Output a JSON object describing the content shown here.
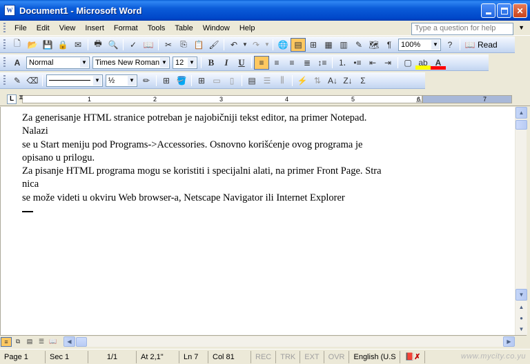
{
  "window": {
    "title": "Document1 - Microsoft Word",
    "icon_text": "W"
  },
  "menubar": {
    "items": [
      "File",
      "Edit",
      "View",
      "Insert",
      "Format",
      "Tools",
      "Table",
      "Window",
      "Help"
    ],
    "ask_placeholder": "Type a question for help"
  },
  "standard_toolbar": {
    "zoom": "100%",
    "read_label": "Read"
  },
  "formatting_toolbar": {
    "style": "Normal",
    "font": "Times New Roman",
    "size": "12",
    "bold": "B",
    "italic": "I",
    "underline": "U"
  },
  "drawing_toolbar": {
    "line_weight": "½"
  },
  "ruler": {
    "numbers": [
      "1",
      "2",
      "3",
      "4",
      "5",
      "6",
      "7"
    ]
  },
  "document": {
    "lines": [
      "Za generisanje HTML stranice potreban je najobičniji tekst editor, na primer Notepad.",
      "Nalazi",
      "se u Start meniju pod Programs->Accessories. Osnovno korišćenje ovog programa  je",
      "opisano u prilogu.",
      "Za pisanje HTML programa mogu se koristiti i specijalni alati, na primer Front Page. Stra",
      "nica",
      "se može videti u okviru Web browser-a, Netscape Navigator ili Internet Explorer"
    ]
  },
  "statusbar": {
    "page": "Page 1",
    "sec": "Sec 1",
    "pages": "1/1",
    "at": "At 2,1\"",
    "ln": "Ln 7",
    "col": "Col 81",
    "rec": "REC",
    "trk": "TRK",
    "ext": "EXT",
    "ovr": "OVR",
    "language": "English (U.S",
    "watermark": "www.mycity.co.yu"
  }
}
